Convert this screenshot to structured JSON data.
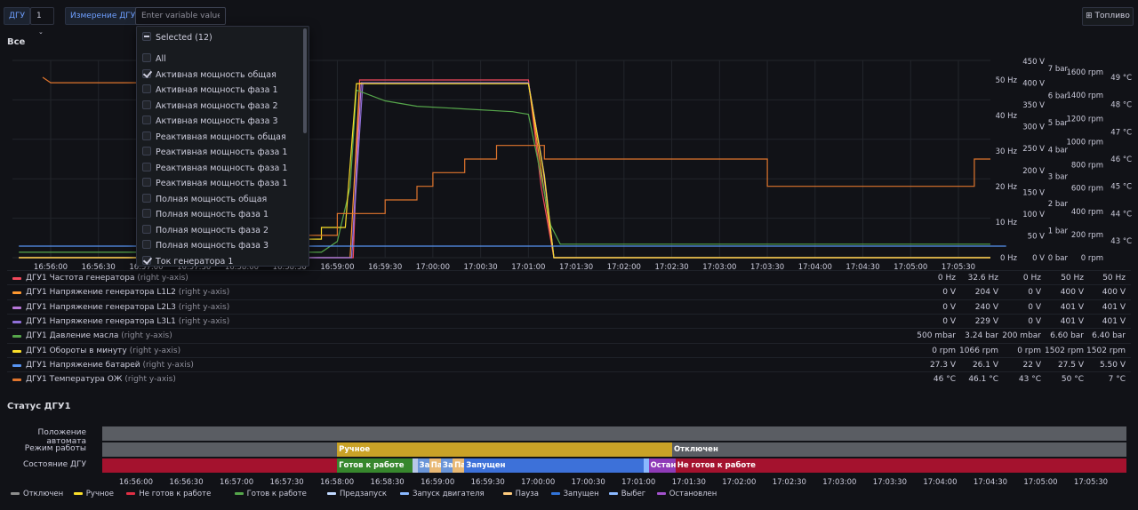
{
  "toolbar": {
    "dgu_label": "ДГУ",
    "dgu_value": "1",
    "measure_label": "Измерение ДГУ",
    "variable_placeholder": "Enter variable value",
    "fuel_button": "Топливо"
  },
  "dropdown": {
    "header": "Selected (12)",
    "items": [
      {
        "label": "All",
        "checked": false
      },
      {
        "label": "Активная мощность общая",
        "checked": true
      },
      {
        "label": "Активная мощность фаза 1",
        "checked": false
      },
      {
        "label": "Активная мощность фаза 2",
        "checked": false
      },
      {
        "label": "Активная мощность фаза 3",
        "checked": false
      },
      {
        "label": "Реактивная мощность общая",
        "checked": false
      },
      {
        "label": "Реактивная мощность фаза 1",
        "checked": false
      },
      {
        "label": "Реактивная мощность фаза 1",
        "checked": false
      },
      {
        "label": "Реактивная мощность фаза 1",
        "checked": false
      },
      {
        "label": "Полная мощность общая",
        "checked": false
      },
      {
        "label": "Полная мощность фаза 1",
        "checked": false
      },
      {
        "label": "Полная мощность фаза 2",
        "checked": false
      },
      {
        "label": "Полная мощность фаза 3",
        "checked": false
      },
      {
        "label": "Ток генератора 1",
        "checked": true
      }
    ]
  },
  "panel_all": {
    "title": "Все"
  },
  "chart_data": {
    "type": "line",
    "x_ticks": [
      "16:56:00",
      "16:56:30",
      "16:57:00",
      "16:57:30",
      "16:58:00",
      "16:58:30",
      "16:59:00",
      "16:59:30",
      "17:00:00",
      "17:00:30",
      "17:01:00",
      "17:01:30",
      "17:02:00",
      "17:02:30",
      "17:03:00",
      "17:03:30",
      "17:04:00",
      "17:04:30",
      "17:05:00",
      "17:05:30"
    ],
    "right_axes": [
      {
        "unit": "Hz",
        "ticks": [
          "50 Hz",
          "40 Hz",
          "30 Hz",
          "20 Hz",
          "10 Hz",
          "0 Hz"
        ]
      },
      {
        "unit": "V",
        "ticks": [
          "450 V",
          "400 V",
          "350 V",
          "300 V",
          "250 V",
          "200 V",
          "150 V",
          "100 V",
          "50 V",
          "0 V"
        ]
      },
      {
        "unit": "bar",
        "ticks": [
          "7 bar",
          "6 bar",
          "5 bar",
          "4 bar",
          "3 bar",
          "2 bar",
          "1 bar",
          "0 bar"
        ]
      },
      {
        "unit": "rpm",
        "ticks": [
          "1600 rpm",
          "1400 rpm",
          "1200 rpm",
          "1000 rpm",
          "800 rpm",
          "600 rpm",
          "400 rpm",
          "200 rpm",
          "0 rpm"
        ]
      },
      {
        "unit": "°C",
        "ticks": [
          "49 °C",
          "48 °C",
          "47 °C",
          "46 °C",
          "45 °C",
          "44 °C",
          "43 °C"
        ]
      }
    ],
    "series": [
      {
        "name": "ДГУ1 Частота генератора",
        "color": "#f2495c",
        "axis": "Hz",
        "points": [
          [
            "16:55:40",
            0
          ],
          [
            "16:59:10",
            0
          ],
          [
            "16:59:14",
            50
          ],
          [
            "17:01:00",
            50
          ],
          [
            "17:01:08",
            20
          ],
          [
            "17:01:16",
            0
          ],
          [
            "17:06:00",
            0
          ]
        ]
      },
      {
        "name": "ДГУ1 Напряжение генератора L1L2",
        "color": "#ff9830",
        "axis": "V",
        "points": [
          [
            "16:55:40",
            0
          ],
          [
            "16:59:08",
            0
          ],
          [
            "16:59:14",
            400
          ],
          [
            "17:01:00",
            400
          ],
          [
            "17:01:08",
            200
          ],
          [
            "17:01:16",
            0
          ],
          [
            "17:06:00",
            0
          ]
        ]
      },
      {
        "name": "ДГУ1 Напряжение генератора L2L3",
        "color": "#b877d9",
        "axis": "V",
        "points": [
          [
            "16:55:40",
            0
          ],
          [
            "16:59:09",
            0
          ],
          [
            "16:59:15",
            401
          ],
          [
            "17:01:00",
            401
          ],
          [
            "17:01:09",
            210
          ],
          [
            "17:01:16",
            0
          ],
          [
            "17:06:00",
            0
          ]
        ]
      },
      {
        "name": "ДГУ1 Напряжение генератора L3L1",
        "color": "#8f6fd8",
        "axis": "V",
        "points": [
          [
            "16:55:40",
            0
          ],
          [
            "16:59:09",
            0
          ],
          [
            "16:59:16",
            401
          ],
          [
            "17:01:00",
            401
          ],
          [
            "17:01:10",
            190
          ],
          [
            "17:01:16",
            0
          ],
          [
            "17:06:00",
            0
          ]
        ]
      },
      {
        "name": "ДГУ1 Давление масла",
        "color": "#56a64b",
        "axis": "bar",
        "points": [
          [
            "16:55:40",
            0.2
          ],
          [
            "16:58:50",
            0.2
          ],
          [
            "16:59:00",
            0.6
          ],
          [
            "16:59:08",
            2.6
          ],
          [
            "16:59:12",
            6.2
          ],
          [
            "16:59:30",
            5.8
          ],
          [
            "16:59:50",
            5.6
          ],
          [
            "17:00:20",
            5.5
          ],
          [
            "17:00:50",
            5.4
          ],
          [
            "17:01:00",
            5.3
          ],
          [
            "17:01:08",
            3.0
          ],
          [
            "17:01:14",
            1.2
          ],
          [
            "17:01:20",
            0.5
          ],
          [
            "17:06:00",
            0.5
          ]
        ]
      },
      {
        "name": "ДГУ1 Обороты в минуту",
        "color": "#fade2a",
        "axis": "rpm",
        "points": [
          [
            "16:55:40",
            0
          ],
          [
            "16:58:40",
            0
          ],
          [
            "16:58:40",
            160
          ],
          [
            "16:58:50",
            160
          ],
          [
            "16:58:50",
            260
          ],
          [
            "16:59:05",
            260
          ],
          [
            "16:59:12",
            1500
          ],
          [
            "17:01:00",
            1500
          ],
          [
            "17:01:10",
            700
          ],
          [
            "17:01:16",
            0
          ],
          [
            "17:06:00",
            0
          ]
        ]
      },
      {
        "name": "ДГУ1 Напряжение батарей",
        "color": "#5794f2",
        "axis": "V",
        "points": [
          [
            "16:55:40",
            27.3
          ],
          [
            "17:06:00",
            27.3
          ]
        ]
      },
      {
        "name": "ДГУ1 Температура ОЖ",
        "color": "#e0752d",
        "axis": "°C",
        "points": [
          [
            "16:55:55",
            49.0
          ],
          [
            "16:56:00",
            48.8
          ],
          [
            "16:57:00",
            48.8
          ],
          [
            "16:57:00",
            48.5
          ],
          [
            "16:58:00",
            48.5
          ],
          [
            "16:58:00",
            46.0
          ],
          [
            "16:58:40",
            46.0
          ],
          [
            "16:58:40",
            43.2
          ],
          [
            "16:59:00",
            43.2
          ],
          [
            "16:59:00",
            44.0
          ],
          [
            "16:59:30",
            44.0
          ],
          [
            "16:59:30",
            44.5
          ],
          [
            "16:59:50",
            44.5
          ],
          [
            "16:59:50",
            45.0
          ],
          [
            "17:00:00",
            45.0
          ],
          [
            "17:00:00",
            45.5
          ],
          [
            "17:00:20",
            45.5
          ],
          [
            "17:00:20",
            46.0
          ],
          [
            "17:00:40",
            46.0
          ],
          [
            "17:00:40",
            46.5
          ],
          [
            "17:01:10",
            46.5
          ],
          [
            "17:01:10",
            46.0
          ],
          [
            "17:03:30",
            46.0
          ],
          [
            "17:03:30",
            45.0
          ],
          [
            "17:05:40",
            45.0
          ],
          [
            "17:05:40",
            46.0
          ],
          [
            "17:06:00",
            46.0
          ]
        ]
      }
    ]
  },
  "legend": {
    "rows": [
      {
        "name": "ДГУ1 Частота генератора",
        "axis_note": " (right y-axis)",
        "color": "#f2495c",
        "values": [
          "0 Hz",
          "32.6 Hz",
          "0 Hz",
          "50 Hz",
          "50 Hz"
        ]
      },
      {
        "name": "ДГУ1 Напряжение генератора L1L2",
        "axis_note": " (right y-axis)",
        "color": "#ff9830",
        "values": [
          "0 V",
          "204 V",
          "0 V",
          "400 V",
          "400 V"
        ]
      },
      {
        "name": "ДГУ1 Напряжение генератора L2L3",
        "axis_note": " (right y-axis)",
        "color": "#b877d9",
        "values": [
          "0 V",
          "240 V",
          "0 V",
          "401 V",
          "401 V"
        ]
      },
      {
        "name": "ДГУ1 Напряжение генератора L3L1",
        "axis_note": " (right y-axis)",
        "color": "#8f6fd8",
        "values": [
          "0 V",
          "229 V",
          "0 V",
          "401 V",
          "401 V"
        ]
      },
      {
        "name": "ДГУ1 Давление масла",
        "axis_note": " (right y-axis)",
        "color": "#56a64b",
        "values": [
          "500 mbar",
          "3.24 bar",
          "200 mbar",
          "6.60 bar",
          "6.40 bar"
        ]
      },
      {
        "name": "ДГУ1 Обороты в минуту",
        "axis_note": " (right y-axis)",
        "color": "#fade2a",
        "values": [
          "0 rpm",
          "1066 rpm",
          "0 rpm",
          "1502 rpm",
          "1502 rpm"
        ]
      },
      {
        "name": "ДГУ1 Напряжение батарей",
        "axis_note": " (right y-axis)",
        "color": "#5794f2",
        "values": [
          "27.3 V",
          "26.1 V",
          "22 V",
          "27.5 V",
          "5.50 V"
        ]
      },
      {
        "name": "ДГУ1 Температура ОЖ",
        "axis_note": " (right y-axis)",
        "color": "#e0752d",
        "values": [
          "46 °C",
          "46.1 °C",
          "43 °C",
          "50 °C",
          "7 °C"
        ]
      }
    ]
  },
  "status_panel": {
    "title": "Статус ДГУ1",
    "rows": [
      {
        "label": "Положение автомата",
        "segments": [
          {
            "start": "16:55:40",
            "end": "17:06:00",
            "text": "",
            "color": "#5a5d63"
          }
        ]
      },
      {
        "label": "Режим работы",
        "segments": [
          {
            "start": "16:55:40",
            "end": "16:58:00",
            "text": "",
            "color": "#5a5d63"
          },
          {
            "start": "16:58:00",
            "end": "17:01:20",
            "text": "Ручное",
            "color": "#c9a227"
          },
          {
            "start": "17:01:20",
            "end": "17:06:00",
            "text": "Отключен",
            "color": "#5a5d63"
          }
        ]
      },
      {
        "label": "Состояние ДГУ",
        "segments": [
          {
            "start": "16:55:40",
            "end": "16:58:00",
            "text": "",
            "color": "#a4122e"
          },
          {
            "start": "16:58:00",
            "end": "16:58:45",
            "text": "Готов к работе",
            "color": "#37872d"
          },
          {
            "start": "16:58:45",
            "end": "16:58:48",
            "text": "",
            "color": "#b8c8e8"
          },
          {
            "start": "16:58:48",
            "end": "16:58:55",
            "text": "За",
            "color": "#6a95d8"
          },
          {
            "start": "16:58:55",
            "end": "16:59:02",
            "text": "Па",
            "color": "#e8b874"
          },
          {
            "start": "16:59:02",
            "end": "16:59:09",
            "text": "За",
            "color": "#6a95d8"
          },
          {
            "start": "16:59:09",
            "end": "16:59:16",
            "text": "Па",
            "color": "#e8b874"
          },
          {
            "start": "16:59:16",
            "end": "17:01:03",
            "text": "Запущен",
            "color": "#3d71d9"
          },
          {
            "start": "17:01:03",
            "end": "17:01:06",
            "text": "",
            "color": "#8ab8ff"
          },
          {
            "start": "17:01:06",
            "end": "17:01:22",
            "text": "Остан",
            "color": "#8f3bb8"
          },
          {
            "start": "17:01:22",
            "end": "17:06:00",
            "text": "Не готов к работе",
            "color": "#a4122e"
          }
        ]
      }
    ],
    "x_ticks": [
      "16:56:00",
      "16:56:30",
      "16:57:00",
      "16:57:30",
      "16:58:00",
      "16:58:30",
      "16:59:00",
      "16:59:30",
      "17:00:00",
      "17:00:30",
      "17:01:00",
      "17:01:30",
      "17:02:00",
      "17:02:30",
      "17:03:00",
      "17:03:30",
      "17:04:00",
      "17:04:30",
      "17:05:00",
      "17:05:30"
    ],
    "legend": [
      {
        "label": "Отключен",
        "color": "#8e8e8e"
      },
      {
        "label": "Ручное",
        "color": "#fade2a"
      },
      {
        "label": "Не готов к работе",
        "color": "#e02f44"
      },
      {
        "label": "Готов к работе",
        "color": "#56a64b"
      },
      {
        "label": "Предзапуск",
        "color": "#c0d8ff"
      },
      {
        "label": "Запуск двигателя",
        "color": "#8ab8ff"
      },
      {
        "label": "Пауза",
        "color": "#ffcb7d"
      },
      {
        "label": "Запущен",
        "color": "#3274d9"
      },
      {
        "label": "Выбег",
        "color": "#8ab8ff"
      },
      {
        "label": "Остановлен",
        "color": "#a352cc"
      }
    ]
  }
}
